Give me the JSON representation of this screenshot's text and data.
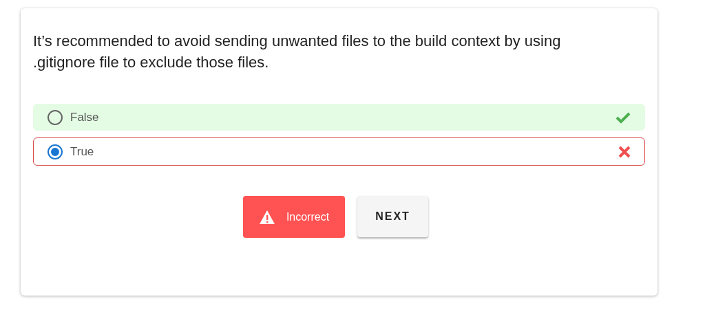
{
  "question": "It’s recommended to avoid sending unwanted files to the build context by using .gitignore file to exclude those files.",
  "options": [
    {
      "label": "False",
      "selected": false,
      "correct": true
    },
    {
      "label": "True",
      "selected": true,
      "correct": false
    }
  ],
  "feedback": {
    "label": "Incorrect",
    "kind": "incorrect"
  },
  "next_button": "NEXT"
}
